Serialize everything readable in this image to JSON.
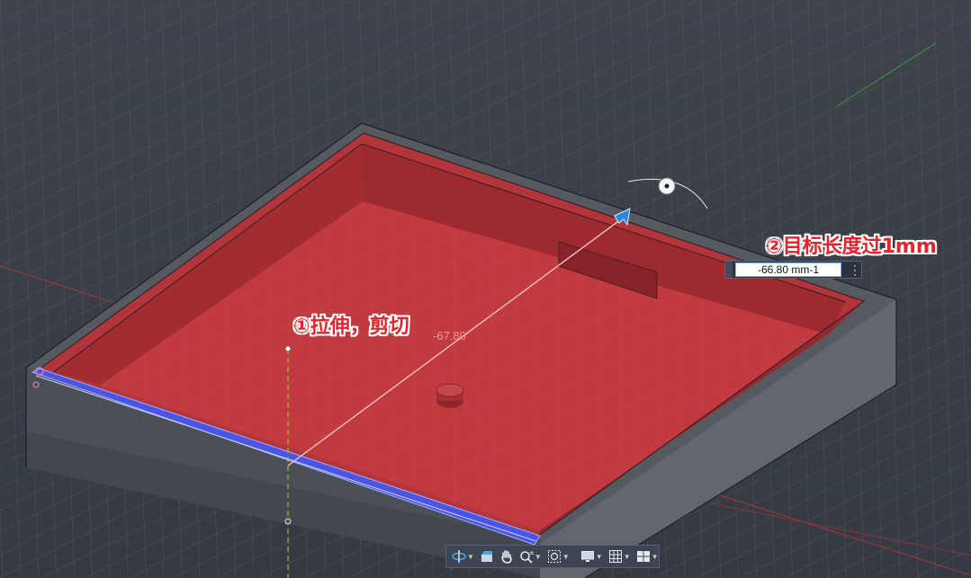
{
  "annotations": {
    "step1": "①拉伸，剪切",
    "step2": "②目标长度过1mm"
  },
  "dimension": {
    "ghost_value": "-67.80",
    "input_value": "-66.80 mm-1"
  },
  "toolbar": {
    "items": [
      "orbit",
      "look-at",
      "pan",
      "zoom",
      "fit",
      "display-settings",
      "grid",
      "viewports"
    ]
  },
  "colors": {
    "background": "#3b4048",
    "cut_preview": "#c0353a",
    "selected_edge": "#4a55e0",
    "annotation_text": "#e8212a"
  }
}
